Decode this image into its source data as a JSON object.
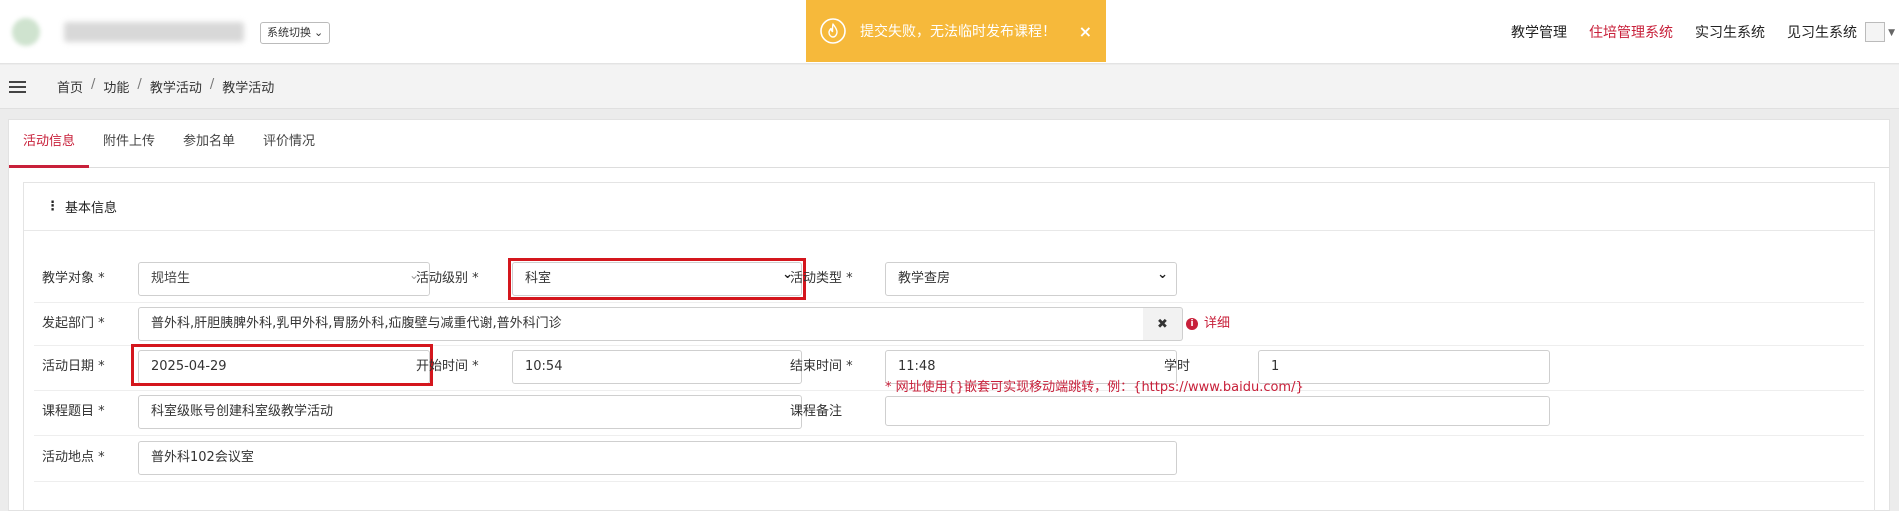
{
  "header": {
    "system_switch_label": "系统切换",
    "nav": [
      "教学管理",
      "住培管理系统",
      "实习生系统",
      "见习生系统"
    ],
    "nav_active_index": 1
  },
  "toast": {
    "message": "提交失败，无法临时发布课程！",
    "close": "×",
    "color": "#f6b93b"
  },
  "breadcrumb": [
    "首页",
    "功能",
    "教学活动",
    "教学活动"
  ],
  "tabs": [
    "活动信息",
    "附件上传",
    "参加名单",
    "评价情况"
  ],
  "active_tab_index": 0,
  "section_title": "基本信息",
  "form": {
    "teaching_target": {
      "label": "教学对象 *",
      "value": "规培生"
    },
    "activity_level": {
      "label": "活动级别 *",
      "value": "科室"
    },
    "activity_type": {
      "label": "活动类型 *",
      "value": "教学查房"
    },
    "department": {
      "label": "发起部门 *",
      "value": "普外科,肝胆胰脾外科,乳甲外科,胃肠外科,疝腹壁与减重代谢,普外科门诊",
      "clear": "✖",
      "detail": "详细"
    },
    "activity_date": {
      "label": "活动日期 *",
      "value": "2025-04-29"
    },
    "start_time": {
      "label": "开始时间 *",
      "value": "10:54"
    },
    "end_time": {
      "label": "结束时间 *",
      "value": "11:48"
    },
    "hours": {
      "label": "学时",
      "value": "1"
    },
    "course_title": {
      "label": "课程题目 *",
      "value": "科室级账号创建科室级教学活动"
    },
    "course_note": {
      "label": "课程备注",
      "value": "",
      "hint": "* 网址使用{}嵌套可实现移动端跳转，例：{https://www.baidu.com/}"
    },
    "location": {
      "label": "活动地点 *",
      "value": "普外科102会议室"
    }
  },
  "accent_color": "#c8203a",
  "highlight_color": "#d4161d"
}
